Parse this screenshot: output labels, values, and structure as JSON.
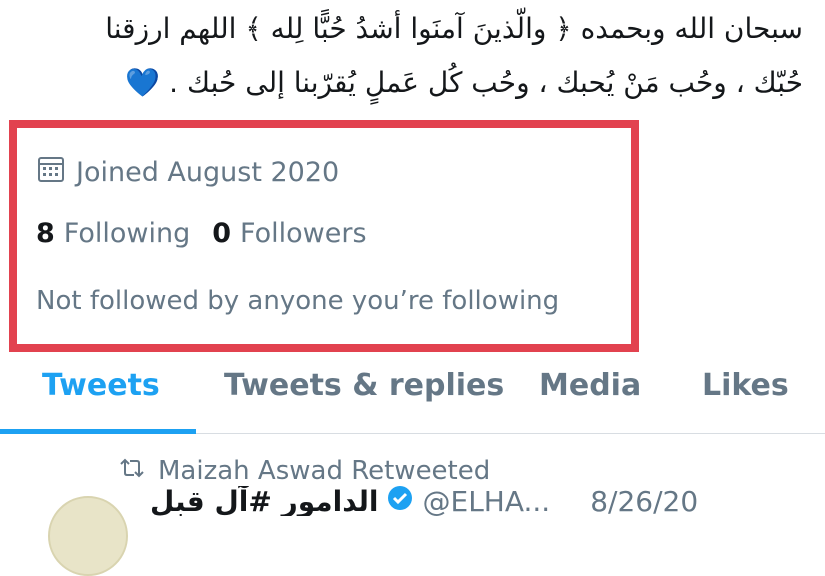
{
  "bio": {
    "line1": "سبحان الله وبحمده ﴿ والّذينَ آمنَوا أشدُ حُبًّا لِله ﴾ اللهم ارزقنا",
    "line2": "حُبّك ، وحُب مَنْ يُحبك ، وحُب كُل عَملٍ يُقرّبنا إلى حُبك .",
    "heart": "💙"
  },
  "profile": {
    "joined": "Joined August 2020",
    "following_count": "8",
    "following_label": "Following",
    "followers_count": "0",
    "followers_label": "Followers",
    "not_followed": "Not followed by anyone you’re following"
  },
  "tabs": [
    {
      "label": "Tweets",
      "active": true
    },
    {
      "label": "Tweets & replies",
      "active": false
    },
    {
      "label": "Media",
      "active": false
    },
    {
      "label": "Likes",
      "active": false
    }
  ],
  "tweet": {
    "retweet_text": "Maizah Aswad Retweeted",
    "name": "الدامور #آل قبل",
    "handle": "@ELHA...",
    "date": "8/26/20"
  },
  "colors": {
    "accent": "#1da1f2",
    "highlight_box": "#e2424f",
    "muted_text": "#657786",
    "heart": "#3b82f6"
  },
  "icons": {
    "calendar": "calendar-icon",
    "retweet": "retweet-icon",
    "verified": "verified-badge-icon"
  }
}
